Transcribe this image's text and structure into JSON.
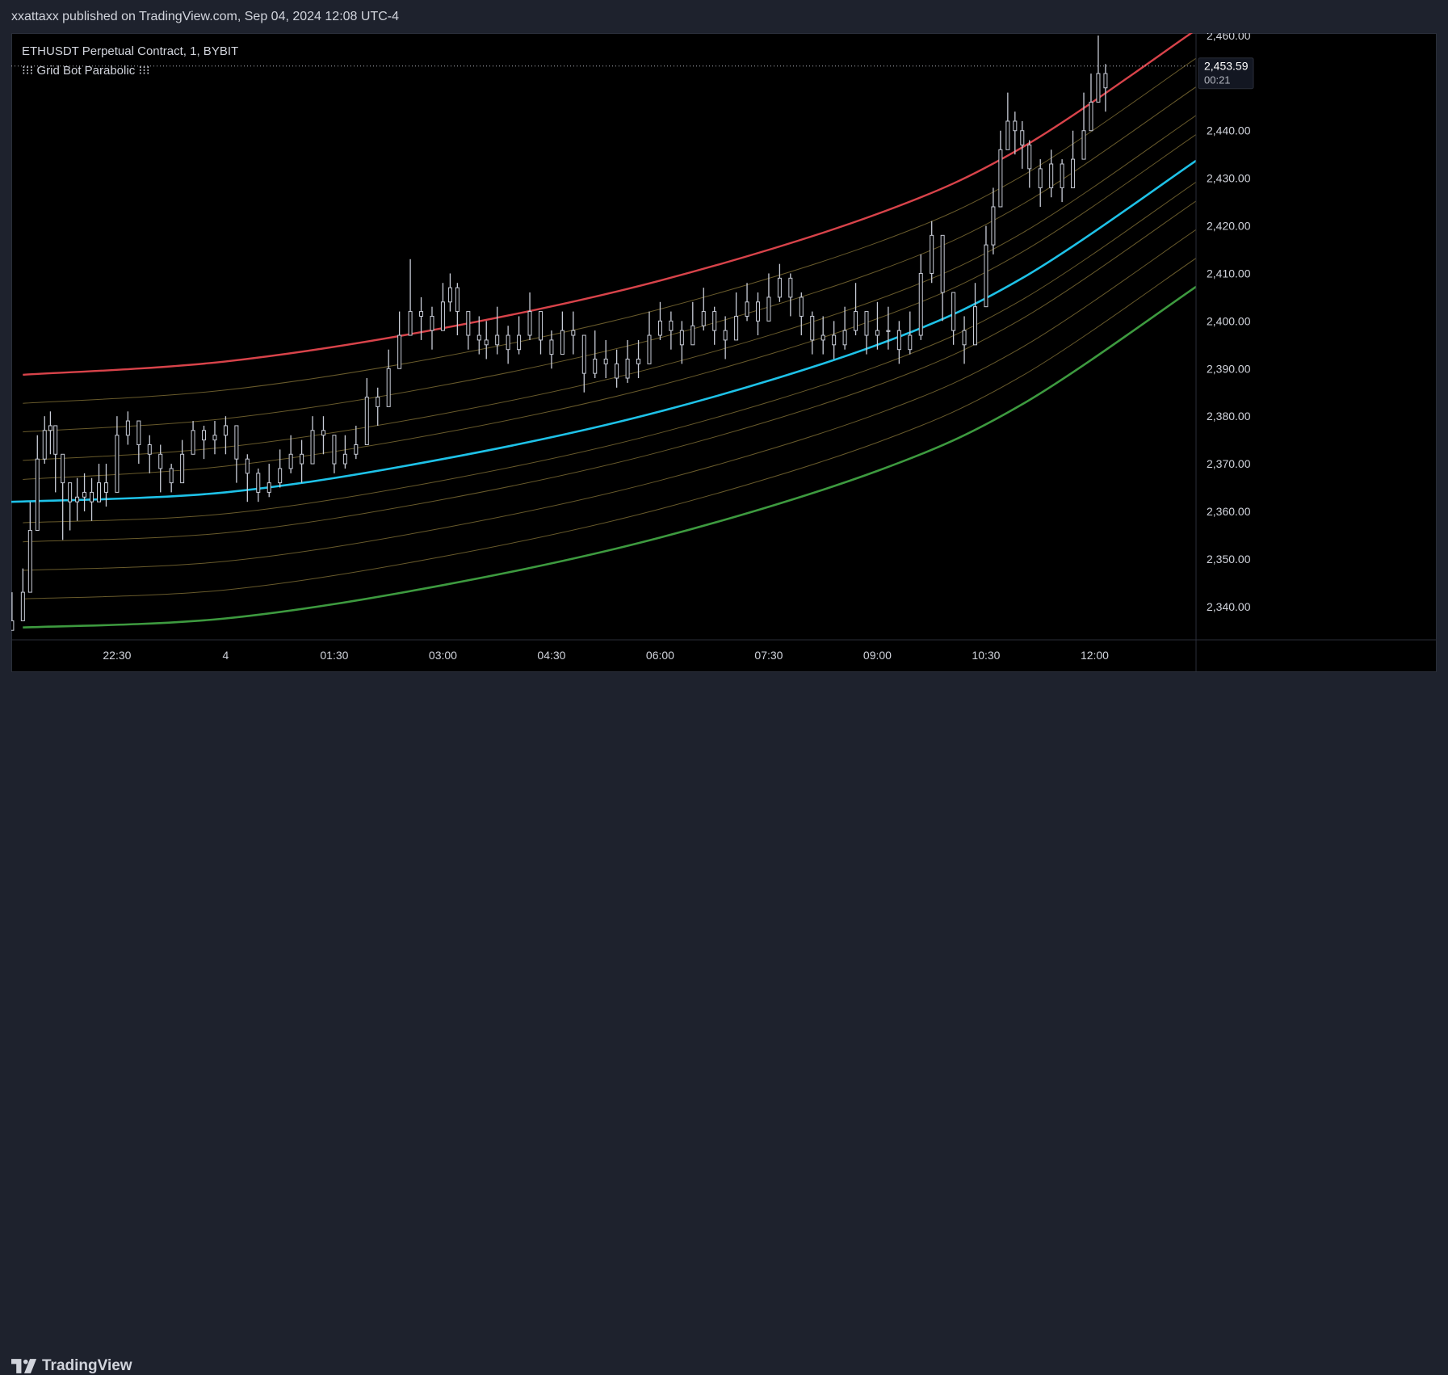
{
  "header": {
    "published_text": "xxattaxx published on TradingView.com, Sep 04, 2024 12:08 UTC-4"
  },
  "legend": {
    "symbol": "ETHUSDT Perpetual Contract, 1, BYBIT",
    "indicator": "⁝⁝⁝ Grid Bot Parabolic ⁝⁝⁝"
  },
  "footer": {
    "brand": "TradingView"
  },
  "current_price": {
    "value": "2,453.59",
    "countdown": "00:21"
  },
  "colors": {
    "background": "#000000",
    "upper_band": "#d8434a",
    "middle_band": "#1ec2e8",
    "lower_band": "#3d9a3f",
    "grid_lines": "#7a6a32",
    "candles": "#c9cdd8"
  },
  "chart_data": {
    "type": "line",
    "title": "ETHUSDT Perpetual Contract, 1, BYBIT",
    "xlabel": "",
    "ylabel": "",
    "ylim": [
      2333.0,
      2460.5
    ],
    "y_ticks": [
      "2,460.00",
      "2,450.00",
      "2,440.00",
      "2,430.00",
      "2,420.00",
      "2,410.00",
      "2,400.00",
      "2,390.00",
      "2,380.00",
      "2,370.00",
      "2,360.00",
      "2,350.00",
      "2,340.00"
    ],
    "y_tick_values": [
      2460,
      2450,
      2440,
      2430,
      2420,
      2410,
      2400,
      2390,
      2380,
      2370,
      2360,
      2350,
      2340
    ],
    "x_ticks": [
      "22:30",
      "4",
      "01:30",
      "03:00",
      "04:30",
      "06:00",
      "07:30",
      "09:00",
      "10:30",
      "12:00"
    ],
    "x_tick_hours": [
      -1.5,
      0,
      1.5,
      3,
      4.5,
      6,
      7.5,
      9,
      10.5,
      12
    ],
    "x_range_hours": [
      -2.96,
      13.4
    ],
    "grid": false,
    "series": [
      {
        "type": "candles",
        "x_hours": [
          -2.95,
          -2.8,
          -2.7,
          -2.6,
          -2.5,
          -2.42,
          -2.35,
          -2.25,
          -2.15,
          -2.05,
          -1.95,
          -1.85,
          -1.75,
          -1.65,
          -1.5,
          -1.35,
          -1.2,
          -1.05,
          -0.9,
          -0.75,
          -0.6,
          -0.45,
          -0.3,
          -0.15,
          0,
          0.15,
          0.3,
          0.45,
          0.6,
          0.75,
          0.9,
          1.05,
          1.2,
          1.35,
          1.5,
          1.65,
          1.8,
          1.95,
          2.1,
          2.25,
          2.4,
          2.55,
          2.7,
          2.85,
          3.0,
          3.1,
          3.2,
          3.35,
          3.5,
          3.6,
          3.75,
          3.9,
          4.05,
          4.2,
          4.35,
          4.5,
          4.65,
          4.8,
          4.95,
          5.1,
          5.25,
          5.4,
          5.55,
          5.7,
          5.85,
          6.0,
          6.15,
          6.3,
          6.45,
          6.6,
          6.75,
          6.9,
          7.05,
          7.2,
          7.35,
          7.5,
          7.65,
          7.8,
          7.95,
          8.1,
          8.25,
          8.4,
          8.55,
          8.7,
          8.85,
          9.0,
          9.15,
          9.3,
          9.45,
          9.6,
          9.75,
          9.9,
          10.05,
          10.2,
          10.35,
          10.5,
          10.6,
          10.7,
          10.8,
          10.9,
          11.0,
          11.1,
          11.25,
          11.4,
          11.55,
          11.7,
          11.85,
          11.95,
          12.05,
          12.15
        ],
        "close": [
          2337,
          2343,
          2356,
          2371,
          2377,
          2378,
          2372,
          2366,
          2362,
          2363,
          2364,
          2362,
          2366,
          2364,
          2376,
          2379,
          2374,
          2372,
          2369,
          2366,
          2372,
          2377,
          2375,
          2376,
          2378,
          2371,
          2368,
          2364,
          2366,
          2369,
          2372,
          2370,
          2377,
          2376,
          2370,
          2372,
          2374,
          2384,
          2382,
          2390,
          2397,
          2402,
          2401,
          2398,
          2404,
          2407,
          2402,
          2397,
          2396,
          2395,
          2397,
          2394,
          2397,
          2402,
          2396,
          2393,
          2398,
          2397,
          2389,
          2392,
          2391,
          2388,
          2392,
          2391,
          2397,
          2400,
          2398,
          2395,
          2399,
          2402,
          2398,
          2396,
          2401,
          2404,
          2400,
          2405,
          2409,
          2405,
          2401,
          2396,
          2397,
          2395,
          2398,
          2402,
          2397,
          2398,
          2398,
          2394,
          2397,
          2410,
          2418,
          2406,
          2398,
          2395,
          2403,
          2416,
          2424,
          2436,
          2442,
          2440,
          2437,
          2432,
          2428,
          2433,
          2428,
          2434,
          2440,
          2446,
          2452,
          2449
        ],
        "high": [
          2343,
          2348,
          2362,
          2376,
          2380,
          2381,
          2378,
          2370,
          2366,
          2367,
          2368,
          2367,
          2370,
          2370,
          2380,
          2381,
          2378,
          2376,
          2374,
          2370,
          2375,
          2379,
          2378,
          2379,
          2380,
          2378,
          2372,
          2369,
          2370,
          2373,
          2376,
          2375,
          2380,
          2380,
          2376,
          2376,
          2378,
          2388,
          2386,
          2394,
          2402,
          2413,
          2405,
          2403,
          2408,
          2410,
          2408,
          2402,
          2401,
          2400,
          2403,
          2399,
          2401,
          2406,
          2402,
          2398,
          2402,
          2402,
          2394,
          2398,
          2396,
          2394,
          2396,
          2396,
          2402,
          2404,
          2402,
          2400,
          2404,
          2407,
          2403,
          2401,
          2406,
          2408,
          2406,
          2410,
          2412,
          2410,
          2406,
          2402,
          2401,
          2400,
          2403,
          2408,
          2402,
          2404,
          2403,
          2400,
          2402,
          2414,
          2421,
          2414,
          2406,
          2401,
          2408,
          2420,
          2428,
          2440,
          2448,
          2444,
          2442,
          2438,
          2434,
          2436,
          2434,
          2440,
          2448,
          2452,
          2460,
          2454
        ],
        "low": [
          2335,
          2337,
          2343,
          2356,
          2370,
          2372,
          2364,
          2354,
          2356,
          2358,
          2360,
          2358,
          2362,
          2361,
          2368,
          2374,
          2370,
          2368,
          2364,
          2364,
          2366,
          2372,
          2371,
          2372,
          2372,
          2366,
          2362,
          2362,
          2363,
          2365,
          2368,
          2366,
          2370,
          2372,
          2368,
          2369,
          2371,
          2376,
          2378,
          2384,
          2390,
          2397,
          2396,
          2394,
          2398,
          2402,
          2397,
          2394,
          2393,
          2392,
          2393,
          2391,
          2393,
          2396,
          2393,
          2390,
          2393,
          2393,
          2385,
          2388,
          2388,
          2386,
          2387,
          2388,
          2392,
          2396,
          2394,
          2391,
          2395,
          2398,
          2395,
          2392,
          2396,
          2400,
          2397,
          2400,
          2404,
          2401,
          2397,
          2393,
          2393,
          2392,
          2394,
          2397,
          2393,
          2394,
          2394,
          2391,
          2393,
          2396,
          2408,
          2400,
          2395,
          2391,
          2395,
          2403,
          2414,
          2424,
          2436,
          2435,
          2432,
          2428,
          2424,
          2426,
          2425,
          2428,
          2434,
          2440,
          2446,
          2444
        ]
      },
      {
        "type": "band",
        "role": "upper",
        "x_hours": [
          -2.8,
          0,
          3,
          6,
          9,
          11,
          13.4
        ],
        "values": [
          2388.7,
          2391.5,
          2398.5,
          2408.5,
          2422.5,
          2436.5,
          2461.2
        ]
      },
      {
        "type": "band",
        "role": "grid",
        "x_hours": [
          -2.8,
          0,
          3,
          6,
          9,
          11,
          13.4
        ],
        "values": [
          2382.7,
          2385.5,
          2392.5,
          2402.5,
          2416.5,
          2430.5,
          2455.2
        ]
      },
      {
        "type": "band",
        "role": "grid",
        "x_hours": [
          -2.8,
          0,
          3,
          6,
          9,
          11,
          13.4
        ],
        "values": [
          2376.7,
          2379.5,
          2386.5,
          2396.5,
          2410.5,
          2424.5,
          2449.2
        ]
      },
      {
        "type": "band",
        "role": "grid",
        "x_hours": [
          -2.8,
          0,
          3,
          6,
          9,
          11,
          13.4
        ],
        "values": [
          2370.7,
          2373.5,
          2380.5,
          2390.5,
          2404.5,
          2418.5,
          2443.2
        ]
      },
      {
        "type": "band",
        "role": "grid",
        "x_hours": [
          -2.8,
          0,
          3,
          6,
          9,
          11,
          13.4
        ],
        "values": [
          2366.7,
          2369.5,
          2376.5,
          2386.5,
          2400.5,
          2414.5,
          2439.2
        ]
      },
      {
        "type": "band",
        "role": "middle",
        "x_hours": [
          -2.96,
          0,
          3,
          6,
          9,
          11,
          13.4
        ],
        "values": [
          2362.0,
          2364.0,
          2371.0,
          2381.0,
          2395.0,
          2409.0,
          2433.7
        ]
      },
      {
        "type": "band",
        "role": "grid",
        "x_hours": [
          -2.8,
          0,
          3,
          6,
          9,
          11,
          13.4
        ],
        "values": [
          2357.6,
          2359.5,
          2366.5,
          2376.5,
          2390.5,
          2404.5,
          2429.2
        ]
      },
      {
        "type": "band",
        "role": "grid",
        "x_hours": [
          -2.8,
          0,
          3,
          6,
          9,
          11,
          13.4
        ],
        "values": [
          2353.6,
          2355.5,
          2362.5,
          2372.5,
          2386.5,
          2400.5,
          2425.2
        ]
      },
      {
        "type": "band",
        "role": "grid",
        "x_hours": [
          -2.8,
          0,
          3,
          6,
          9,
          11,
          13.4
        ],
        "values": [
          2347.6,
          2349.5,
          2356.5,
          2366.5,
          2380.5,
          2394.5,
          2419.2
        ]
      },
      {
        "type": "band",
        "role": "grid",
        "x_hours": [
          -2.8,
          0,
          3,
          6,
          9,
          11,
          13.4
        ],
        "values": [
          2341.6,
          2343.5,
          2350.5,
          2360.5,
          2374.5,
          2388.5,
          2413.2
        ]
      },
      {
        "type": "band",
        "role": "lower",
        "x_hours": [
          -2.8,
          0,
          3,
          6,
          9,
          11,
          13.4
        ],
        "values": [
          2335.6,
          2337.5,
          2344.5,
          2354.5,
          2368.5,
          2382.5,
          2407.2
        ]
      }
    ]
  }
}
